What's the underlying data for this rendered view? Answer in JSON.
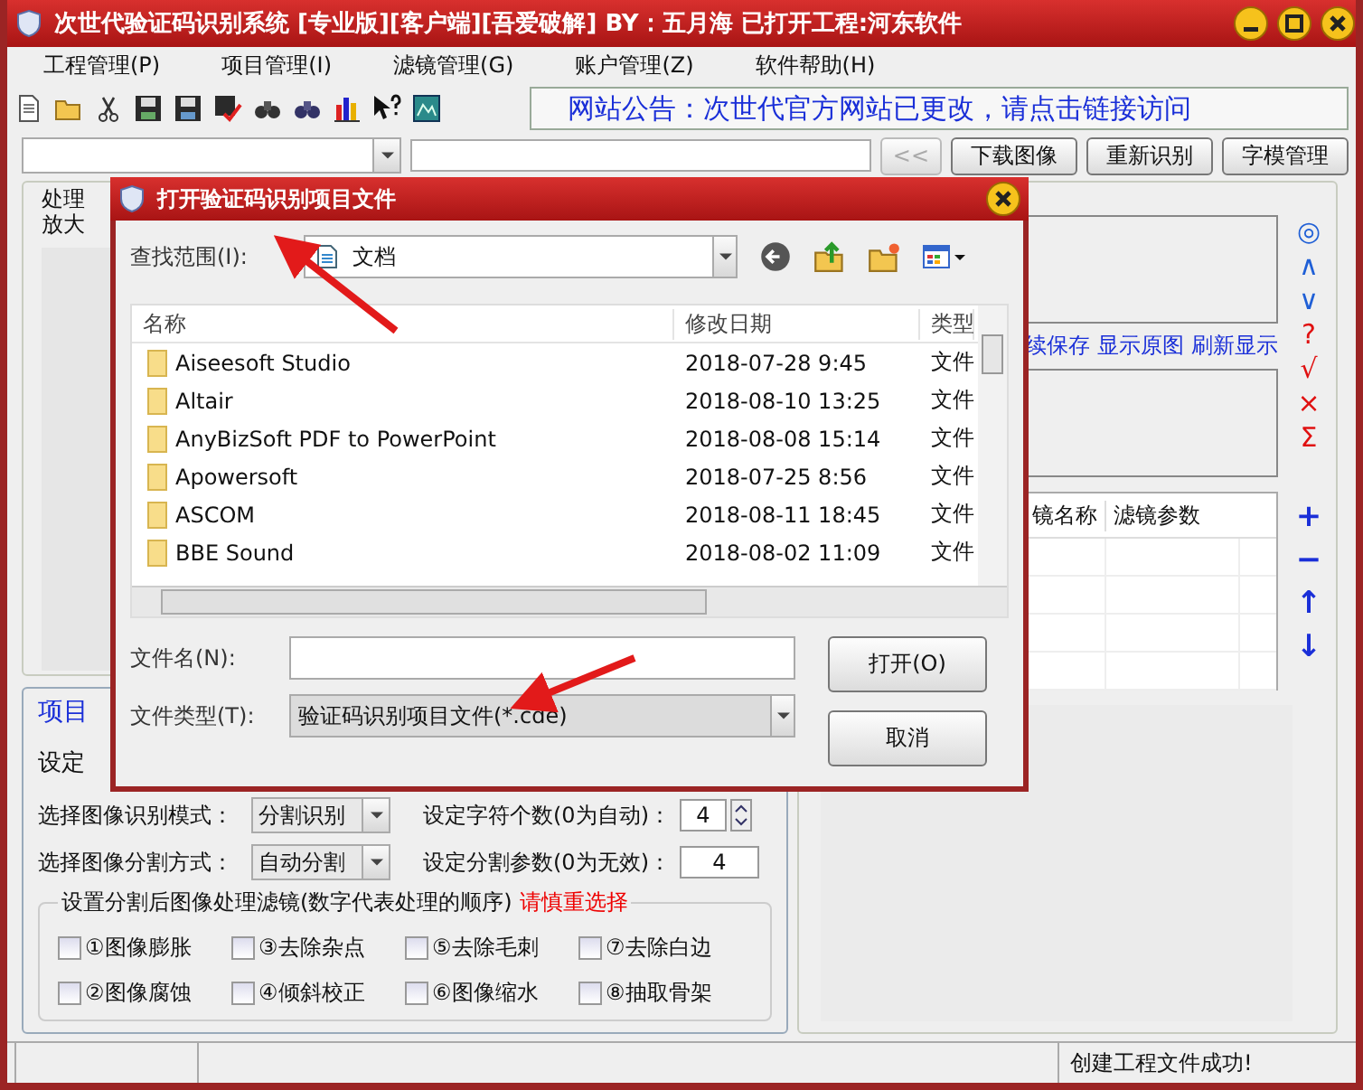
{
  "window": {
    "title": "次世代验证码识别系统 [专业版][客户端][吾爱破解] BY：五月海 已打开工程:河东软件"
  },
  "menu": [
    "工程管理(P)",
    "项目管理(I)",
    "滤镜管理(G)",
    "账户管理(Z)",
    "软件帮助(H)"
  ],
  "toolbar": {
    "notice": "网站公告：次世代官方网站已更改，请点击链接访问"
  },
  "address_bar": {
    "prev_button": {
      "label": "<<",
      "disabled": true
    },
    "buttons": [
      "下载图像",
      "重新识别",
      "字模管理"
    ]
  },
  "preview_group": {
    "lines": [
      "处理",
      "放大"
    ]
  },
  "project_group": {
    "title": "项目",
    "setting_label": "设定",
    "fields": [
      {
        "label": "选择图像识别模式：",
        "kind": "select",
        "value": "分割识别"
      },
      {
        "label": "设定字符个数(0为自动)：",
        "kind": "spin",
        "value": "4"
      },
      {
        "label": "选择图像分割方式：",
        "kind": "select",
        "value": "自动分割"
      },
      {
        "label": "设定分割参数(0为无效)：",
        "kind": "input",
        "value": "4"
      }
    ],
    "filters": {
      "title": "设置分割后图像处理滤镜(数字代表处理的顺序)",
      "warning": "请慎重选择",
      "items": [
        {
          "label": "①图像膨胀",
          "checked": false
        },
        {
          "label": "③去除杂点",
          "checked": false
        },
        {
          "label": "⑤去除毛刺",
          "checked": false
        },
        {
          "label": "⑦去除白边",
          "checked": false
        },
        {
          "label": "②图像腐蚀",
          "checked": false
        },
        {
          "label": "④倾斜校正",
          "checked": false
        },
        {
          "label": "⑥图像缩水",
          "checked": false
        },
        {
          "label": "⑧抽取骨架",
          "checked": false
        }
      ]
    }
  },
  "right_panel": {
    "links": [
      "续保存",
      "显示原图",
      "刷新显示"
    ],
    "tool_icons": [
      {
        "glyph": "◎",
        "color": "#1f5fd6"
      },
      {
        "glyph": "∧",
        "color": "#1f5fd6"
      },
      {
        "glyph": "∨",
        "color": "#1f5fd6"
      },
      {
        "glyph": "?",
        "color": "#e01010"
      },
      {
        "glyph": "√",
        "color": "#e01010"
      },
      {
        "glyph": "×",
        "color": "#e01010"
      },
      {
        "glyph": "Σ",
        "color": "#e01010"
      }
    ],
    "filter_table": {
      "columns": [
        "镜名称",
        "滤镜参数"
      ]
    },
    "list_icons": [
      "+",
      "−",
      "↑",
      "↓"
    ]
  },
  "status_bar": {
    "message": "创建工程文件成功!"
  },
  "dialog": {
    "title": "打开验证码识别项目文件",
    "look_in_label": "查找范围(I):",
    "look_in_value": "文档",
    "columns": [
      "名称",
      "修改日期",
      "类型"
    ],
    "files": [
      {
        "name": "Aiseesoft Studio",
        "date": "2018-07-28 9:45",
        "type": "文件"
      },
      {
        "name": "Altair",
        "date": "2018-08-10 13:25",
        "type": "文件"
      },
      {
        "name": "AnyBizSoft PDF to PowerPoint",
        "date": "2018-08-08 15:14",
        "type": "文件"
      },
      {
        "name": "Apowersoft",
        "date": "2018-07-25 8:56",
        "type": "文件"
      },
      {
        "name": "ASCOM",
        "date": "2018-08-11 18:45",
        "type": "文件"
      },
      {
        "name": "BBE Sound",
        "date": "2018-08-02 11:09",
        "type": "文件"
      }
    ],
    "filename_label": "文件名(N):",
    "open_button": "打开(O)",
    "filetype_label": "文件类型(T):",
    "filetype_value": "验证码识别项目文件(*.cde)",
    "cancel_button": "取消"
  }
}
